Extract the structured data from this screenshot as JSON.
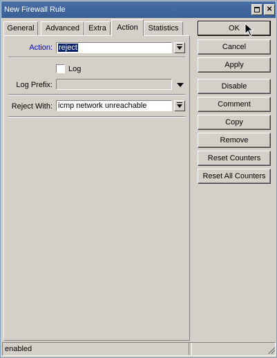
{
  "window": {
    "title": "New Firewall Rule"
  },
  "tabs": [
    {
      "label": "General"
    },
    {
      "label": "Advanced"
    },
    {
      "label": "Extra"
    },
    {
      "label": "Action"
    },
    {
      "label": "Statistics"
    }
  ],
  "active_tab": "Action",
  "form": {
    "action": {
      "label": "Action:",
      "value": "reject"
    },
    "log": {
      "label": "Log",
      "checked": false
    },
    "log_prefix": {
      "label": "Log Prefix:",
      "value": ""
    },
    "reject_with": {
      "label": "Reject With:",
      "value": "icmp network unreachable"
    }
  },
  "buttons": {
    "ok": "OK",
    "cancel": "Cancel",
    "apply": "Apply",
    "disable": "Disable",
    "comment": "Comment",
    "copy": "Copy",
    "remove": "Remove",
    "reset_counters": "Reset Counters",
    "reset_all_counters": "Reset All Counters"
  },
  "status": {
    "text": "enabled"
  },
  "colors": {
    "titlebar": "#3a5f95",
    "action_label": "#0000c8",
    "selection": "#0a246a"
  }
}
